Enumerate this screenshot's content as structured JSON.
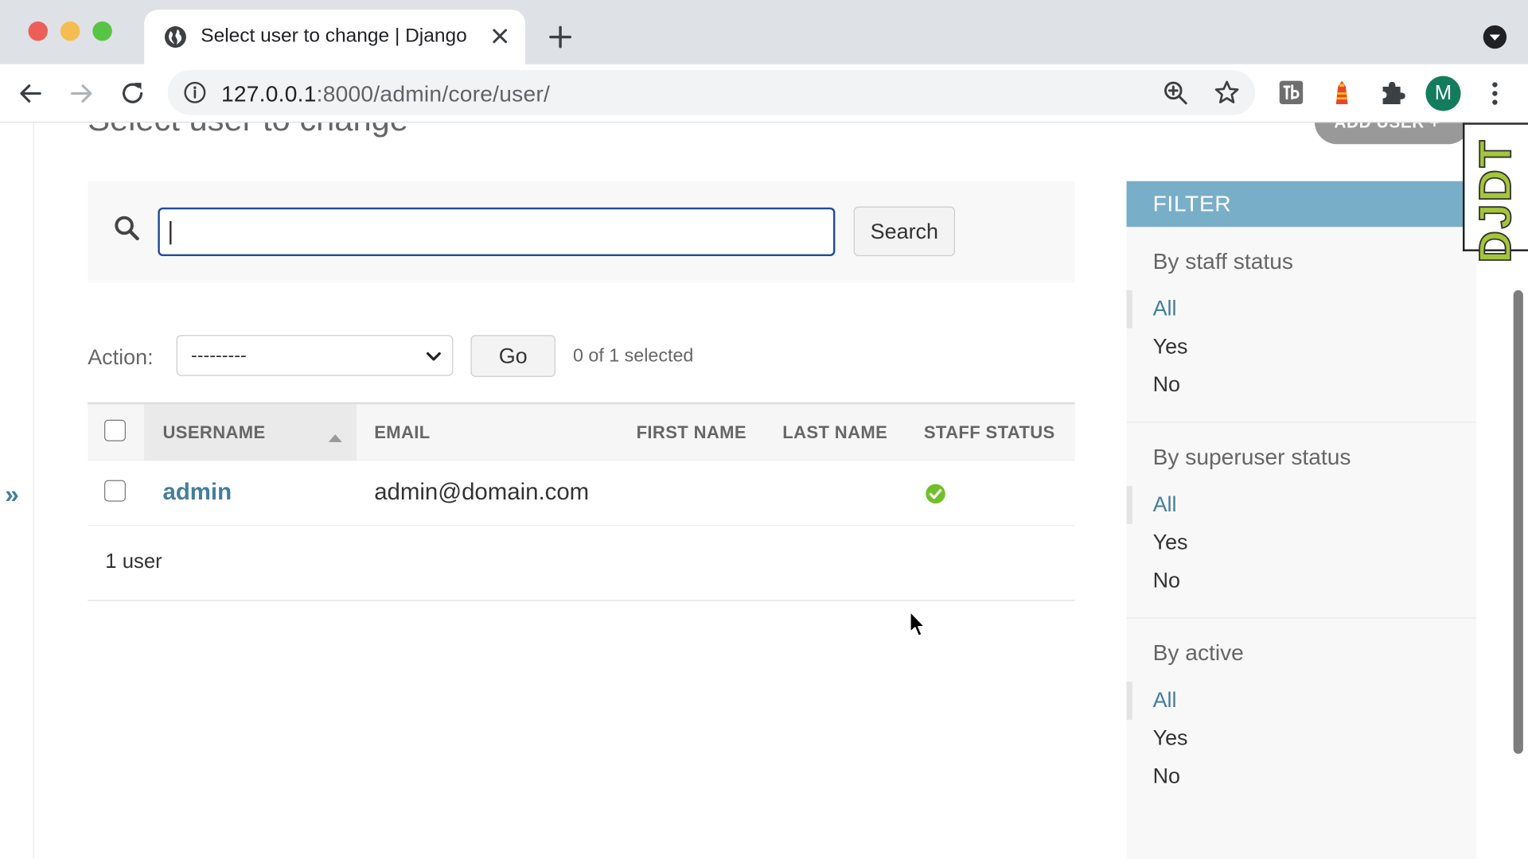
{
  "browser": {
    "tab_title": "Select user to change | Django",
    "url_host": "127.0.0.1",
    "url_rest": ":8000/admin/core/user/",
    "profile_initial": "M"
  },
  "page": {
    "title": "Select user to change",
    "add_user_label": "ADD USER +",
    "search_button": "Search",
    "search_value": "",
    "action_label": "Action:",
    "action_selected": "---------",
    "go_button": "Go",
    "selected_count": "0 of 1 selected",
    "nav_toggle": "»",
    "djdt_label": "DJDT"
  },
  "table": {
    "headers": [
      "USERNAME",
      "EMAIL",
      "FIRST NAME",
      "LAST NAME",
      "STAFF STATUS"
    ],
    "rows": [
      {
        "username": "admin",
        "email": "admin@domain.com",
        "first_name": "",
        "last_name": "",
        "staff_status": "yes"
      }
    ],
    "paginator": "1 user"
  },
  "filter": {
    "title": "FILTER",
    "sections": [
      {
        "title": "By staff status",
        "options": [
          "All",
          "Yes",
          "No"
        ],
        "selected": "All"
      },
      {
        "title": "By superuser status",
        "options": [
          "All",
          "Yes",
          "No"
        ],
        "selected": "All"
      },
      {
        "title": "By active",
        "options": [
          "All",
          "Yes",
          "No"
        ],
        "selected": "All"
      }
    ]
  },
  "colors": {
    "link": "#447e9b",
    "filter_header": "#79aec8",
    "focus_border": "#1e4c9a",
    "success": "#70bf2b"
  }
}
